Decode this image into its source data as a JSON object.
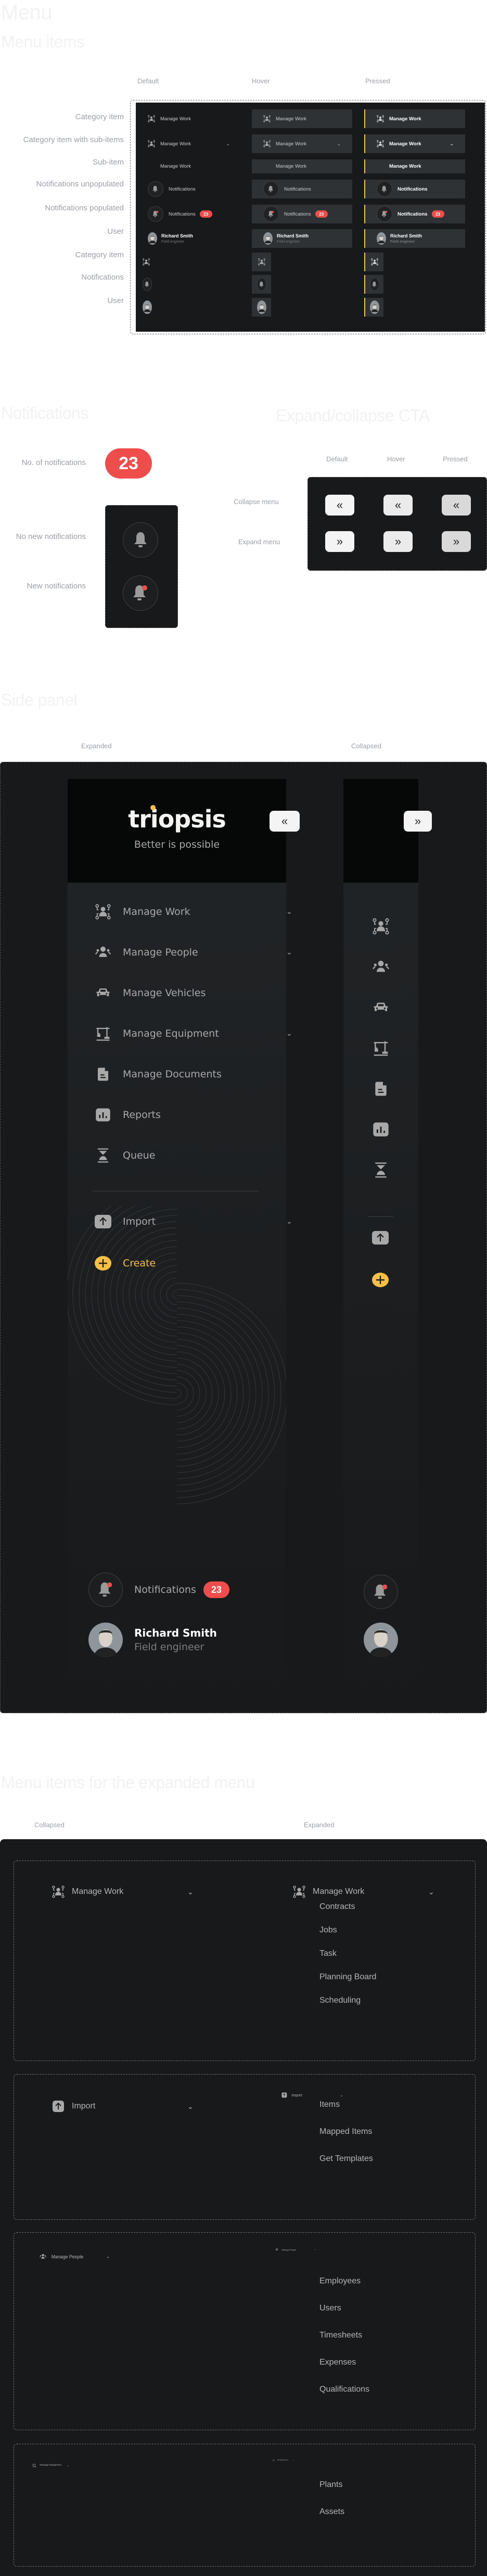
{
  "titles": {
    "menu": "Menu",
    "menu_items": "Menu items",
    "notifications": "Notifications",
    "expand_collapse": "Expand/collapse CTA",
    "side_panel": "Side panel",
    "expanded_menu_items": "Menu items for the expanded menu"
  },
  "states": {
    "default": "Default",
    "hover": "Hover",
    "pressed": "Pressed"
  },
  "menu_items_rows": [
    "Category item",
    "Category item with sub-items",
    "Sub-item",
    "Notifications unpopulated",
    "Notifications populated",
    "User",
    "Category item",
    "Notifications",
    "User"
  ],
  "menu_item": {
    "label": "Manage Work",
    "notifications_label": "Notifications",
    "notification_count": "23",
    "user_name": "Richard Smith",
    "user_role": "Field engineer"
  },
  "notifications_section": {
    "count_label": "No. of notifications",
    "count": "23",
    "no_new_label": "No new notifications",
    "new_label": "New notifications"
  },
  "cta_section": {
    "collapse_label": "Collapse menu",
    "expand_label": "Expand menu",
    "collapse_glyph": "«",
    "expand_glyph": "»"
  },
  "side_panel": {
    "expanded_label": "Expanded",
    "collapsed_label": "Collapsed",
    "brand": "triopsis",
    "tagline": "Better is possible",
    "items": [
      {
        "label": "Manage Work",
        "icon": "manage-work-icon",
        "has_sub": true
      },
      {
        "label": "Manage People",
        "icon": "people-icon",
        "has_sub": true
      },
      {
        "label": "Manage Vehicles",
        "icon": "car-icon",
        "has_sub": false
      },
      {
        "label": "Manage Equipment",
        "icon": "crane-icon",
        "has_sub": true
      },
      {
        "label": "Manage Documents",
        "icon": "document-icon",
        "has_sub": false
      },
      {
        "label": "Reports",
        "icon": "chart-icon",
        "has_sub": false
      },
      {
        "label": "Queue",
        "icon": "hourglass-icon",
        "has_sub": false
      }
    ],
    "import_label": "Import",
    "create_label": "Create",
    "notifications_label": "Notifications",
    "notification_count": "23",
    "user_name": "Richard Smith",
    "user_role": "Field engineer",
    "accent": "#f6c044",
    "badge_color": "#ef4c4c"
  },
  "expanded_menu": {
    "collapsed_label": "Collapsed",
    "expanded_label": "Expanded",
    "groups": [
      {
        "label": "Manage Work",
        "subitems": [
          "Contracts",
          "Jobs",
          "Task",
          "Planning Board",
          "Scheduling"
        ]
      },
      {
        "label": "Import",
        "subitems": [
          "Items",
          "Mapped Items",
          "Get Templates"
        ]
      },
      {
        "label": "Manage People",
        "subitems": [
          "Employees",
          "Users",
          "Timesheets",
          "Expenses",
          "Qualifications"
        ]
      },
      {
        "label": "Manage Equipment",
        "subitems": [
          "Plants",
          "Assets"
        ]
      }
    ]
  }
}
